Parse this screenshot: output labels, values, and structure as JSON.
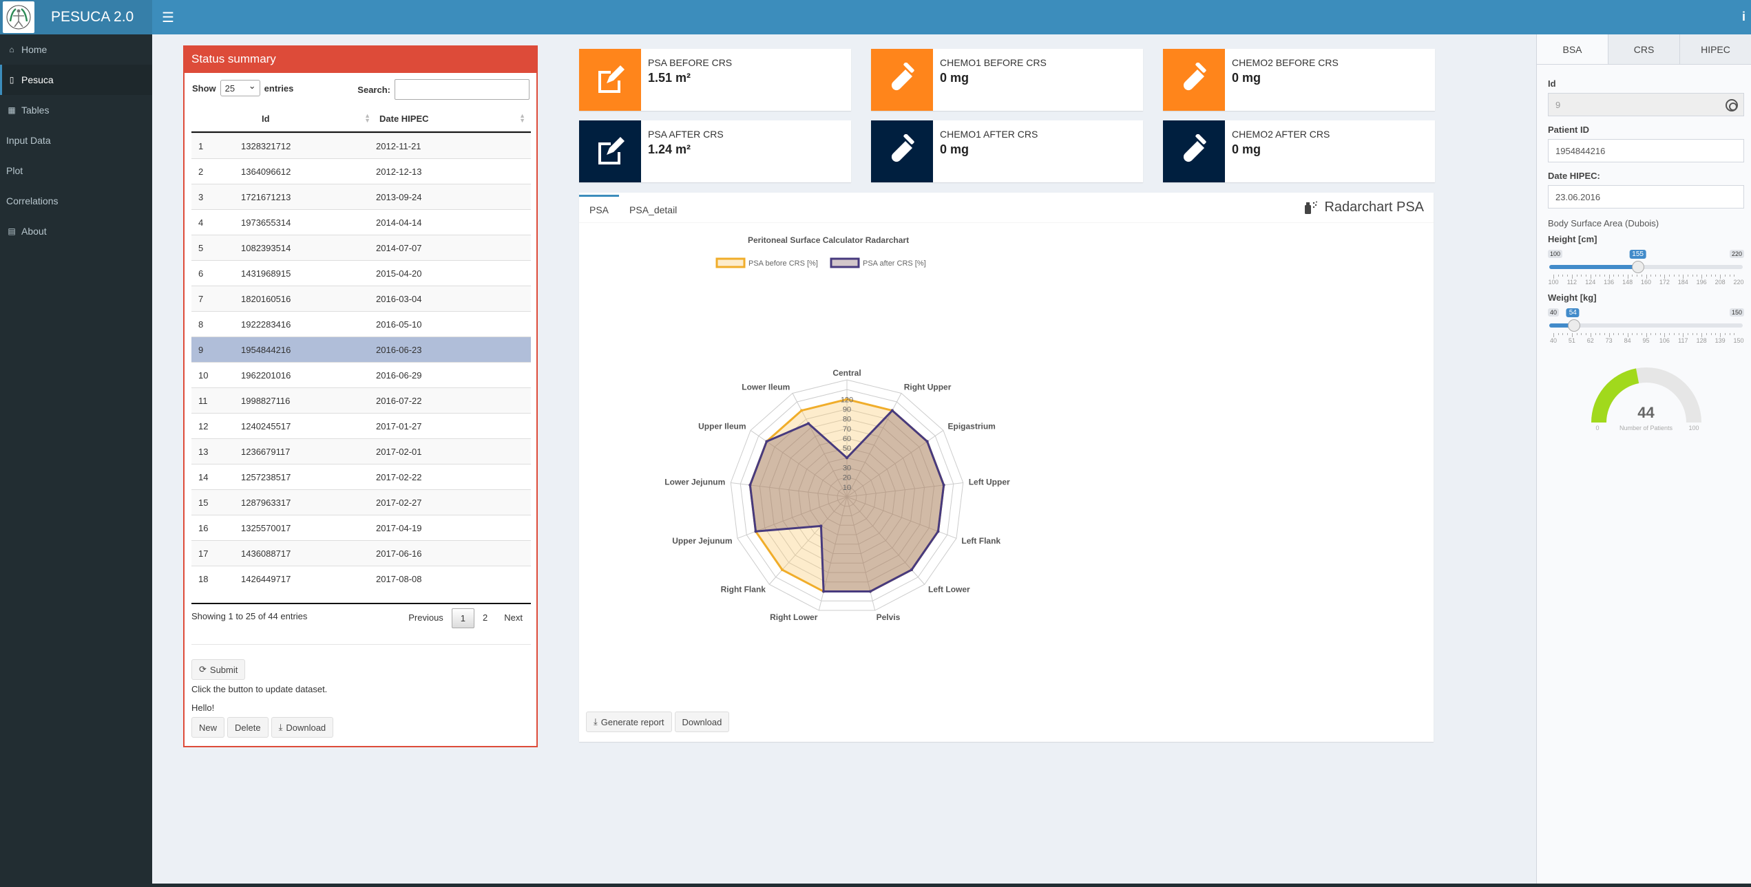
{
  "header": {
    "app_title": "PESUCA 2.0",
    "menu_icon": "☰",
    "info_icon": "i"
  },
  "sidebar": {
    "items": [
      {
        "label": "Home",
        "icon": "home-icon"
      },
      {
        "label": "Pesuca",
        "icon": "mobile-icon",
        "active": true
      },
      {
        "label": "Tables",
        "icon": "table-icon"
      },
      {
        "label": "Input Data",
        "icon": ""
      },
      {
        "label": "Plot",
        "icon": ""
      },
      {
        "label": "Correlations",
        "icon": ""
      },
      {
        "label": "About",
        "icon": "id-card-icon"
      }
    ]
  },
  "status_box": {
    "title": "Status summary",
    "show_label": "Show",
    "entries_value": "25",
    "entries_label": "entries",
    "search_label": "Search:",
    "search_value": "",
    "columns": [
      "",
      "Id",
      "Date HIPEC"
    ],
    "rows": [
      [
        "1",
        "1328321712",
        "2012-11-21"
      ],
      [
        "2",
        "1364096612",
        "2012-12-13"
      ],
      [
        "3",
        "1721671213",
        "2013-09-24"
      ],
      [
        "4",
        "1973655314",
        "2014-04-14"
      ],
      [
        "5",
        "1082393514",
        "2014-07-07"
      ],
      [
        "6",
        "1431968915",
        "2015-04-20"
      ],
      [
        "7",
        "1820160516",
        "2016-03-04"
      ],
      [
        "8",
        "1922283416",
        "2016-05-10"
      ],
      [
        "9",
        "1954844216",
        "2016-06-23"
      ],
      [
        "10",
        "1962201016",
        "2016-06-29"
      ],
      [
        "11",
        "1998827116",
        "2016-07-22"
      ],
      [
        "12",
        "1240245517",
        "2017-01-27"
      ],
      [
        "13",
        "1236679117",
        "2017-02-01"
      ],
      [
        "14",
        "1257238517",
        "2017-02-22"
      ],
      [
        "15",
        "1287963317",
        "2017-02-27"
      ],
      [
        "16",
        "1325570017",
        "2017-04-19"
      ],
      [
        "17",
        "1436088717",
        "2017-06-16"
      ],
      [
        "18",
        "1426449717",
        "2017-08-08"
      ]
    ],
    "selected_row": 9,
    "info": "Showing 1 to 25 of 44 entries",
    "pagination": {
      "previous": "Previous",
      "pages": [
        "1",
        "2"
      ],
      "current": "1",
      "next": "Next"
    },
    "submit_label": "Submit",
    "note": "Click the button to update dataset.",
    "hello": "Hello!",
    "new_label": "New",
    "delete_label": "Delete",
    "download_label": "Download"
  },
  "value_boxes": [
    {
      "label": "PSA BEFORE CRS",
      "value": "1.51 m²",
      "color": "#ff851b",
      "icon": "edit-icon"
    },
    {
      "label": "CHEMO1 BEFORE CRS",
      "value": "0 mg",
      "color": "#ff851b",
      "icon": "flask-icon"
    },
    {
      "label": "CHEMO2 BEFORE CRS",
      "value": "0 mg",
      "color": "#ff851b",
      "icon": "flask-icon"
    },
    {
      "label": "PSA AFTER CRS",
      "value": "1.24 m²",
      "color": "#001f3f",
      "icon": "edit-icon"
    },
    {
      "label": "CHEMO1 AFTER CRS",
      "value": "0 mg",
      "color": "#001f3f",
      "icon": "flask-icon"
    },
    {
      "label": "CHEMO2 AFTER CRS",
      "value": "0 mg",
      "color": "#001f3f",
      "icon": "flask-icon"
    }
  ],
  "tab_box": {
    "tabs": [
      "PSA",
      "PSA_detail"
    ],
    "active_tab": "PSA",
    "title": "Radarchart PSA",
    "generate_report_label": "Generate report",
    "download_label": "Download"
  },
  "chart_data": {
    "type": "radar",
    "title": "Peritoneal Surface Calculator Radarchart",
    "categories": [
      "Central",
      "Right Upper",
      "Epigastrium",
      "Left Upper",
      "Left Flank",
      "Left Lower",
      "Pelvis",
      "Right Lower",
      "Right Flank",
      "Upper Jejunum",
      "Lower Jejunum",
      "Upper Ileum",
      "Lower Ileum"
    ],
    "rlim": [
      0,
      120
    ],
    "ticks": [
      10,
      20,
      30,
      40,
      50,
      60,
      70,
      80,
      90,
      100
    ],
    "tick_labels": [
      "10",
      "20",
      "30",
      "",
      "50",
      "60",
      "70",
      "80",
      "90",
      "120"
    ],
    "series": [
      {
        "name": "PSA before CRS [%]",
        "values": [
          100,
          100,
          100,
          100,
          100,
          100,
          100,
          100,
          100,
          100,
          100,
          100,
          100
        ],
        "stroke": "#f0ad2a",
        "fill": "rgba(250,200,110,0.35)"
      },
      {
        "name": "PSA after CRS [%]",
        "values": [
          40,
          100,
          100,
          100,
          100,
          100,
          100,
          100,
          40,
          100,
          100,
          100,
          85
        ],
        "stroke": "#473a7e",
        "fill": "rgba(110,70,80,0.30)"
      }
    ],
    "legend": "top",
    "grid": true
  },
  "control_sidebar": {
    "tabs": [
      "BSA",
      "CRS",
      "HIPEC"
    ],
    "active_tab": "BSA",
    "id_label": "Id",
    "id_value": "9",
    "patient_id_label": "Patient ID",
    "patient_id_value": "1954844216",
    "date_label": "Date HIPEC:",
    "date_value": "23.06.2016",
    "bsa_label": "Body Surface Area (Dubois)",
    "height": {
      "label": "Height [cm]",
      "min": 100,
      "max": 220,
      "value": 155,
      "ticks": [
        "100",
        "112",
        "124",
        "136",
        "148",
        "160",
        "172",
        "184",
        "196",
        "208",
        "220"
      ]
    },
    "weight": {
      "label": "Weight [kg]",
      "min": 40,
      "max": 150,
      "value": 54,
      "ticks": [
        "40",
        "51",
        "62",
        "73",
        "84",
        "95",
        "106",
        "117",
        "128",
        "139",
        "150"
      ]
    },
    "gauge": {
      "value": 44,
      "min": 0,
      "max": 100,
      "caption": "Number of Patients",
      "min_label": "0",
      "max_label": "100"
    }
  }
}
